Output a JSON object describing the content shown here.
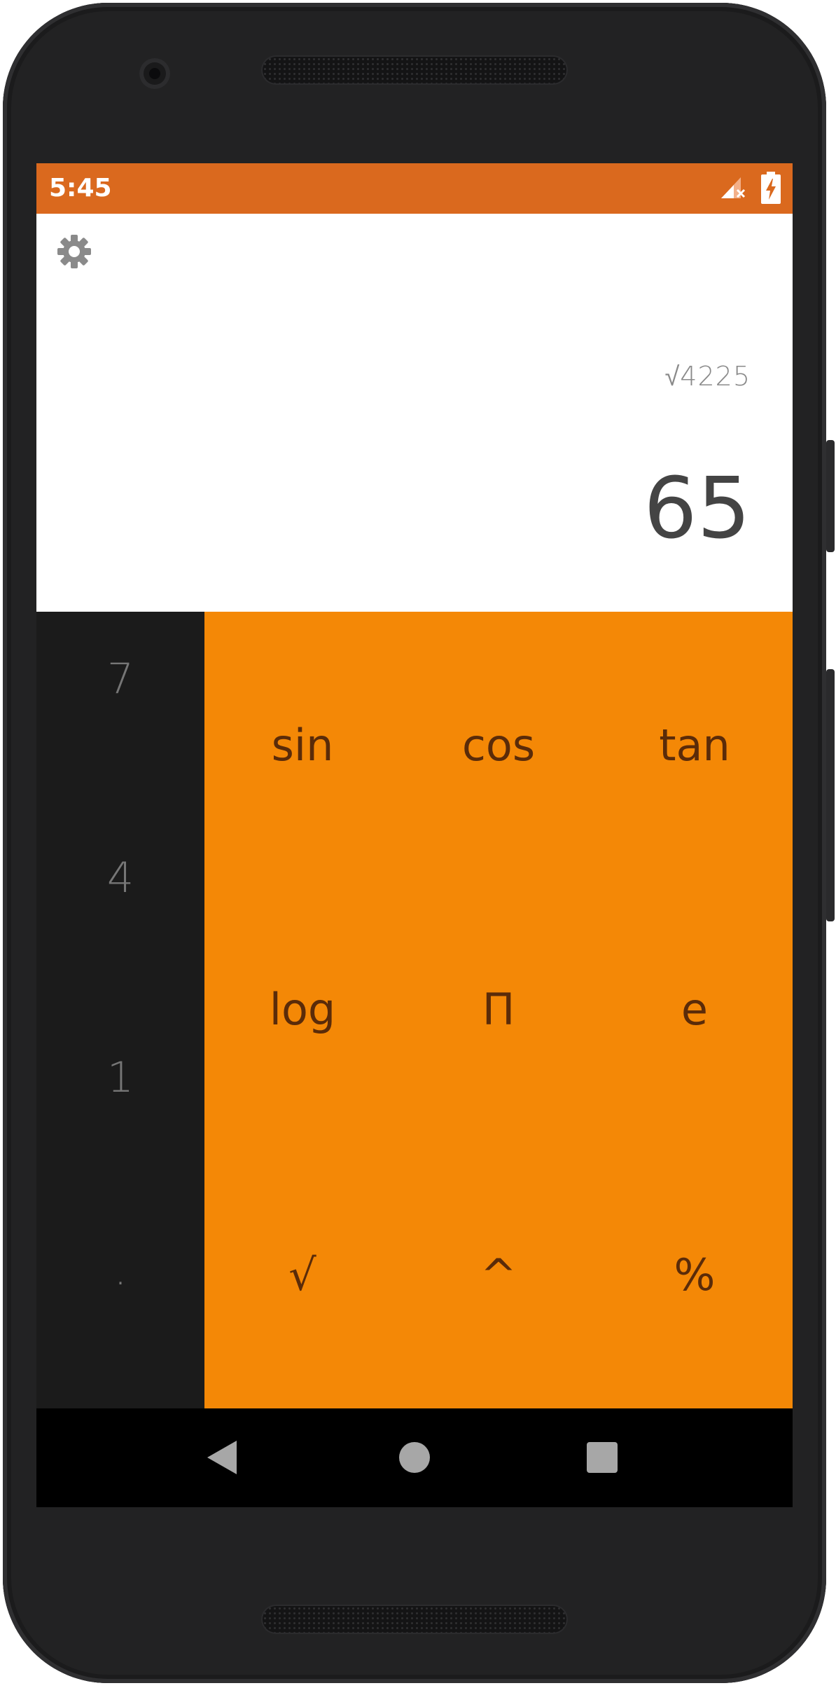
{
  "status_bar": {
    "time": "5:45",
    "signal_icon": "signal-no-service-icon",
    "battery_icon": "battery-charging-icon",
    "color": "#da691e"
  },
  "display": {
    "settings_icon": "gear-icon",
    "expression": "√4225",
    "result": "65"
  },
  "numpad": {
    "keys": [
      "7",
      "4",
      "1",
      "."
    ]
  },
  "advanced_pad": {
    "color": "#f48806",
    "row1": [
      "sin",
      "cos",
      "tan"
    ],
    "row2": [
      "log",
      "Π",
      "e"
    ],
    "row3": [
      "√",
      "^",
      "%"
    ]
  },
  "nav_bar": {
    "back_icon": "back-triangle-icon",
    "home_icon": "home-circle-icon",
    "recents_icon": "recents-square-icon"
  }
}
